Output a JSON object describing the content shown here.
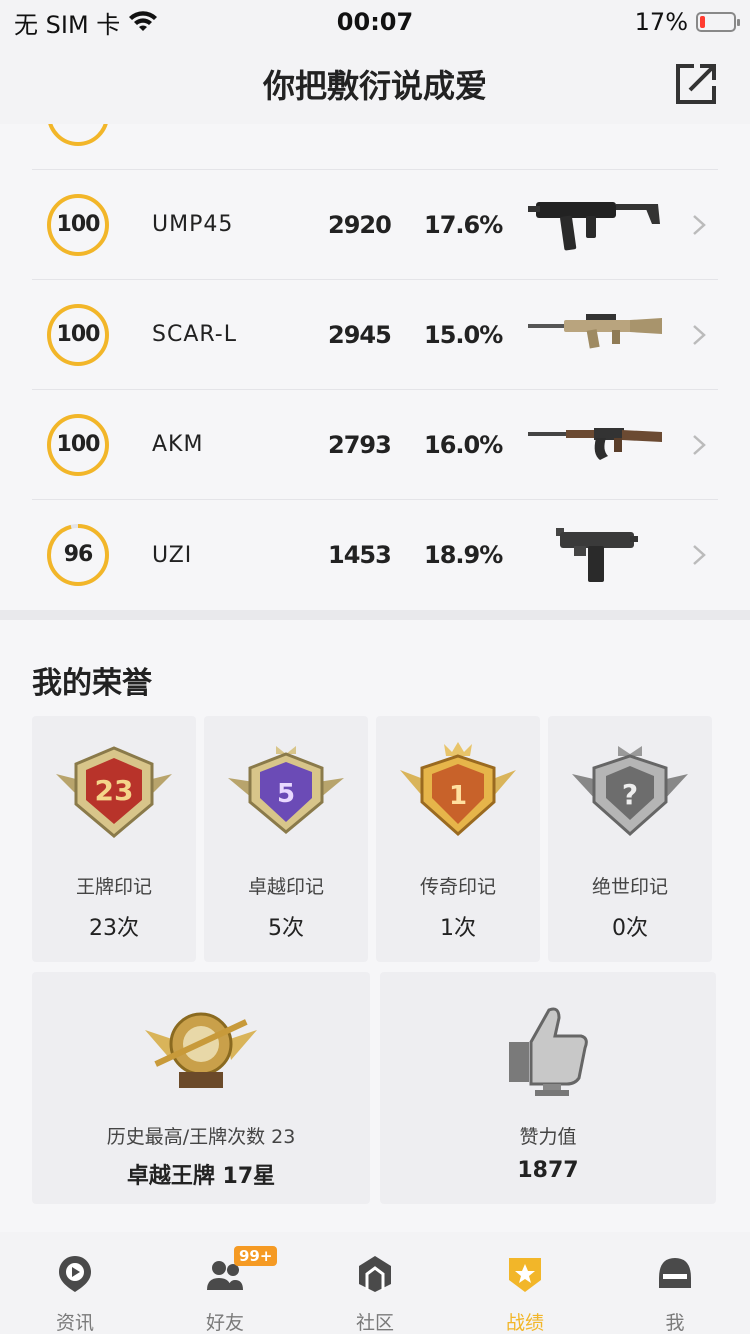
{
  "status_bar": {
    "carrier": "无 SIM 卡",
    "time": "00:07",
    "battery": "17%",
    "battery_level": 0.17
  },
  "header": {
    "title": "你把敷衍说成爱"
  },
  "weapons": [
    {
      "score": "100",
      "progress": 1.0,
      "name": "UMP45",
      "kills": "2920",
      "rate": "17.6%",
      "gun": "smg"
    },
    {
      "score": "100",
      "progress": 1.0,
      "name": "SCAR-L",
      "kills": "2945",
      "rate": "15.0%",
      "gun": "rifle-tan"
    },
    {
      "score": "100",
      "progress": 1.0,
      "name": "AKM",
      "kills": "2793",
      "rate": "16.0%",
      "gun": "rifle-wood"
    },
    {
      "score": "96",
      "progress": 0.96,
      "name": "UZI",
      "kills": "1453",
      "rate": "18.9%",
      "gun": "uzi"
    }
  ],
  "honors": {
    "title": "我的荣誉",
    "badges": [
      {
        "label": "王牌印记",
        "count": "23次",
        "emblem": "23",
        "color": "#c0392b"
      },
      {
        "label": "卓越印记",
        "count": "5次",
        "emblem": "5",
        "color": "#6b4bb6"
      },
      {
        "label": "传奇印记",
        "count": "1次",
        "emblem": "1",
        "color": "#d2691e"
      },
      {
        "label": "绝世印记",
        "count": "0次",
        "emblem": "?",
        "color": "#8a8a8a"
      }
    ],
    "history": {
      "label": "历史最高/王牌次数 23",
      "value": "卓越王牌 17星"
    },
    "likes": {
      "label": "赞力值",
      "value": "1877"
    }
  },
  "tabs": [
    {
      "label": "资讯",
      "icon": "news-icon"
    },
    {
      "label": "好友",
      "icon": "friends-icon",
      "badge": "99+"
    },
    {
      "label": "社区",
      "icon": "community-icon"
    },
    {
      "label": "战绩",
      "icon": "record-icon",
      "active": true
    },
    {
      "label": "我",
      "icon": "helmet-icon"
    }
  ],
  "colors": {
    "accent": "#f2b629",
    "ring": "#f2b629"
  }
}
